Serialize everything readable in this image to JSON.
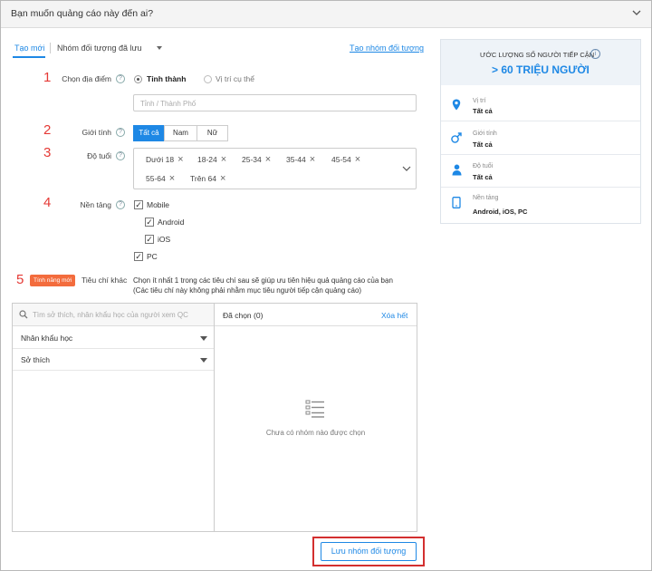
{
  "header": {
    "title": "Bạn muốn quảng cáo này đến ai?",
    "chevron_icon": "chevron-down-icon"
  },
  "tabs": {
    "new": "Tạo mới",
    "saved": "Nhóm đối tượng đã lưu",
    "create_link": "Tạo nhóm đối tượng"
  },
  "steps": {
    "s1": "1",
    "s2": "2",
    "s3": "3",
    "s4": "4",
    "s5": "5"
  },
  "location": {
    "label": "Chọn địa điểm",
    "option_province": "Tỉnh thành",
    "option_specific": "Vị trí cụ thể",
    "placeholder": "Tỉnh / Thành Phố"
  },
  "gender": {
    "label": "Giới tính",
    "options": [
      "Tất cả",
      "Nam",
      "Nữ"
    ],
    "selected": "Tất cả"
  },
  "age": {
    "label": "Độ tuổi",
    "chips": [
      "Dưới 18",
      "18-24",
      "25-34",
      "35-44",
      "45-54",
      "55-64",
      "Trên 64"
    ]
  },
  "platform": {
    "label": "Nền tảng",
    "mobile": "Mobile",
    "android": "Android",
    "ios": "iOS",
    "pc": "PC"
  },
  "other": {
    "badge": "Tính năng mới",
    "label": "Tiêu chí khác",
    "line1": "Chọn ít nhất 1 trong các tiêu chí sau sẽ giúp ưu tiên hiệu quả quảng cáo của bạn",
    "line2": "(Các tiêu chí này không phải nhằm mục tiêu người tiếp cận quảng cáo)"
  },
  "interest_panel": {
    "search_placeholder": "Tìm sở thích, nhân khẩu học của người xem QC",
    "selected_title": "Đã chọn (0)",
    "clear_all": "Xóa hết",
    "cat1": "Nhân khẩu học",
    "cat2": "Sở thích",
    "empty_text": "Chưa có nhóm nào được chọn"
  },
  "save_button": "Lưu nhóm đối tượng",
  "estimate": {
    "title": "ƯỚC LƯỢNG SỐ NGƯỜI TIẾP CẬN",
    "value": "> 60 TRIỆU NGƯỜI",
    "rows": [
      {
        "title": "Vị trí",
        "value": "Tất cả",
        "icon": "location-pin-icon"
      },
      {
        "title": "Giới tính",
        "value": "Tất cả",
        "icon": "gender-icon"
      },
      {
        "title": "Độ tuổi",
        "value": "Tất cả",
        "icon": "person-icon"
      },
      {
        "title": "Nền tảng",
        "value": "Android, iOS, PC",
        "icon": "tablet-icon"
      }
    ]
  },
  "colors": {
    "accent": "#1e88e5",
    "step": "#e53935",
    "badge": "#f36c3d",
    "highlight": "#d32f2f"
  }
}
